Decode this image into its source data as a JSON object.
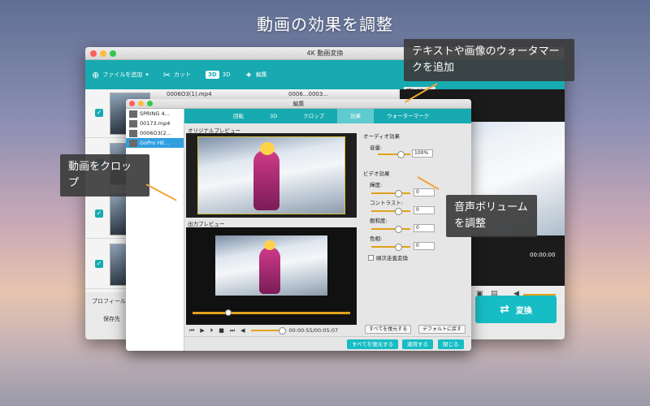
{
  "headline": "動画の効果を調整",
  "main_window": {
    "title": "4K 動画変換",
    "toolbar": {
      "add_file": "ファイルを追加",
      "cut": "カット",
      "three_d_badge": "3D",
      "three_d": "3D",
      "edit": "編集"
    },
    "files": [
      {
        "name": "0006O3(1).mp4",
        "name2": "0006...0003..."
      },
      {
        "name": ""
      },
      {
        "name": ""
      },
      {
        "name": ""
      }
    ],
    "preview_label": "プレビュー",
    "time": "00:00:00",
    "profile_label": "プロフィール",
    "save_label": "保存先",
    "convert_label": "変換"
  },
  "edit_window": {
    "title": "編集",
    "sidebar": [
      {
        "name": "SPRING 4..."
      },
      {
        "name": "00173.mp4"
      },
      {
        "name": "0006O3(2..."
      },
      {
        "name": "GoPro HE..."
      }
    ],
    "tabs": [
      "回転",
      "3D",
      "クロップ",
      "効果",
      "ウォーターマーク"
    ],
    "active_tab": "効果",
    "original_preview": "オリジナルプレビュー",
    "output_preview": "出力プレビュー",
    "playback_time": "00:00:55/00:05:07",
    "audio_section": "オーディオ効果",
    "volume_label": "音量:",
    "volume_value": "100%",
    "video_section": "ビデオ効果",
    "brightness_label": "輝度:",
    "contrast_label": "コントラスト:",
    "saturation_label": "飽和度:",
    "hue_label": "色相:",
    "value_zero": "0",
    "deinterlace_label": "順次走査変換",
    "restore_all": "すべてを復元する",
    "default_restore": "デフォルトに戻す",
    "bottom_restore_all": "すべてを復元する",
    "apply": "適用する",
    "close": "閉じる"
  },
  "callouts": {
    "crop": "動画をクロップ",
    "watermark": "テキストや画像のウォータマークを追加",
    "volume": "音声ボリュームを調整"
  },
  "colors": {
    "accent": "#17aab0",
    "orange": "#f3a43a"
  }
}
